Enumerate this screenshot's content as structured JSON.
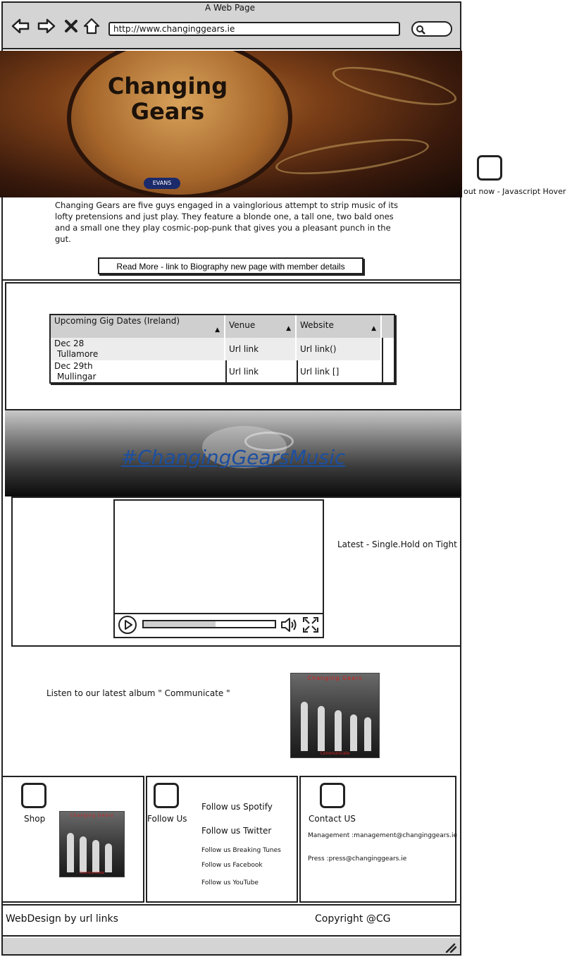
{
  "window": {
    "title": "A Web Page",
    "url": "http://www.changinggears.ie"
  },
  "hero": {
    "band_name_line1": "Changing",
    "band_name_line2": "Gears",
    "drum_brand": "EVANS"
  },
  "hover_note": "out now - Javascript Hover",
  "intro": {
    "text": "Changing Gears are five guys engaged in a vainglorious attempt to strip music of its lofty pretensions and just play. They feature a blonde one, a tall one, two bald ones and a small one they play cosmic-pop-punk that gives you a pleasant punch in the gut.",
    "read_more": "Read More - link to Biography new page with member details"
  },
  "gigs": {
    "headers": [
      "Upcoming Gig Dates (Ireland)",
      "Venue",
      "Website"
    ],
    "rows": [
      {
        "date": "Dec 28",
        "place": "Tullamore",
        "venue": "Url link",
        "website": "Url link()"
      },
      {
        "date": "Dec 29th",
        "place": "Mullingar",
        "venue": "Url link",
        "website": "Url link []"
      }
    ]
  },
  "banner": {
    "hashtag": "#ChangingGearsMusic"
  },
  "video": {
    "caption": "Latest - Single.Hold on Tight",
    "progress": 0.55
  },
  "album": {
    "text": "Listen to our latest album \" Communicate \"",
    "cover_title": "Changing Gears",
    "cover_subtitle": "Communicate"
  },
  "footer_boxes": {
    "shop": "Shop",
    "follow_label": "Follow Us",
    "follow_spotify": "Follow us Spotify",
    "follow_twitter": "Follow us Twitter",
    "follow_breaking": "Follow us Breaking Tunes",
    "follow_facebook": "Follow us Facebook",
    "follow_youtube": "Follow us YouTube",
    "contact_label": "Contact US",
    "management": "Management :management@changinggears.ie",
    "press": "Press :press@changinggears.ie"
  },
  "footer": {
    "webdesign": "WebDesign by url links",
    "copyright": "Copyright @CG"
  }
}
